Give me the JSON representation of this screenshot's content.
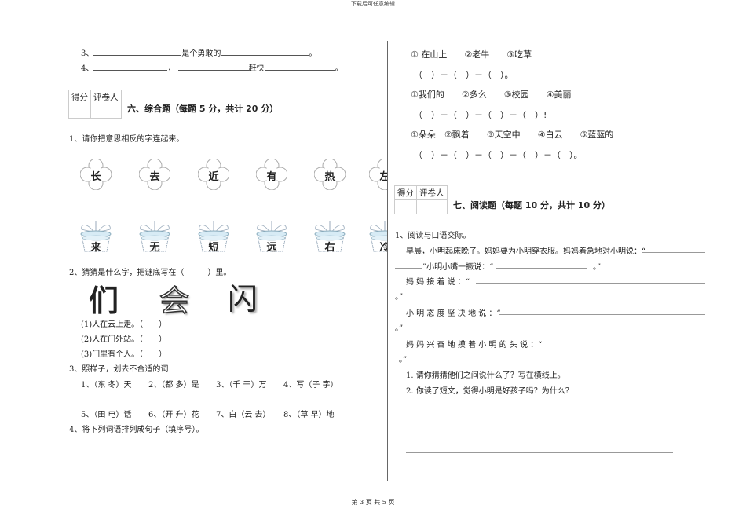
{
  "header": "下载后可任意编辑",
  "footer": "第 3 页 共 5 页",
  "score_box": {
    "col1": "得分",
    "col2": "评卷人"
  },
  "left": {
    "q3_num": "3、",
    "q3_mid": "是个勇敢的",
    "q3_end": "。",
    "q4_num": "4、",
    "q4_comma": "，",
    "q4_mid": "赶快",
    "q4_end": "。",
    "section6_title": "六、综合题（每题 5 分，共计 20 分）",
    "s6q1": "1、请你把意思相反的字连起来。",
    "flowers": [
      "长",
      "去",
      "近",
      "有",
      "热",
      "左"
    ],
    "pots": [
      "来",
      "无",
      "短",
      "远",
      "右",
      "冷"
    ],
    "s6q2": "2、猜猜是什么字，把谜底写在（　　　）里。",
    "riddle_chars": [
      "们",
      "会",
      "闪"
    ],
    "riddles": [
      "(1)人在云上走。（　　）",
      "(2)人在门外站。（　　）",
      "(3)门里有个人。（　　）"
    ],
    "s6q3": "3、照样子，划去不合适的词",
    "words_row1": [
      "1、（东 冬）天",
      "2、（都 多）是",
      "3、（千 干）万",
      "4、写（子 字）"
    ],
    "words_row2": [
      "5、（田 电）话",
      "6、（开 升）花",
      "7、白（云 去）",
      "8、（草 早）地"
    ],
    "s6q4": "4、将下列词语排列成句子（填序号）。"
  },
  "right": {
    "set1": "①  在山上　　②老牛　　③吃草",
    "ans1": "（　）－（　）－（　）。",
    "set2": "①我们的　　②多么　　③校园　　④美丽",
    "ans2": "（　）－（　）－（　）－（　）!",
    "set3": "①朵朵　②飘着　　③天空中　　④白云　　⑤蓝蓝的",
    "ans3": "（　）－（　）－（　）－（　）－（　）。",
    "section7_title": "七、阅读题（每题 10 分，共计 10 分）",
    "r1": "1、阅读与口语交际。",
    "p1": "早晨，小明起床晚了。妈妈要为小明穿衣服。妈妈着急地对小明说：“",
    "p2a": "”小明小嘴一撅说：“",
    "p2b": "。”",
    "p3": "妈 妈 接 着 说 ：“",
    "p3end": "。”",
    "p4": "小 明 态 度 坚 决 地 说 ：“",
    "p4end": "。”",
    "p5": "妈 妈 兴 奋 地 摸 着 小 明 的 头 说 ：“",
    "p5end": "_。”",
    "sq1": "1. 请你猜猜他们之间说什么了？写在横线上。",
    "sq2": "2. 你读了短文，觉得小明是好孩子吗？为什么？"
  }
}
